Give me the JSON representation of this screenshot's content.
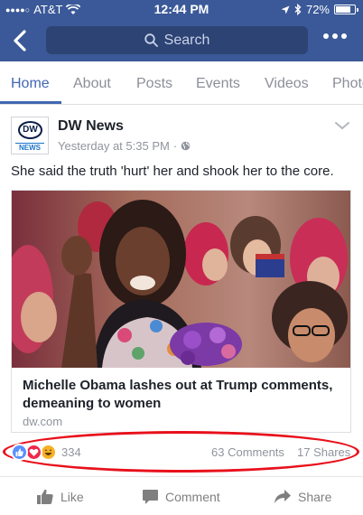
{
  "status_bar": {
    "carrier": "AT&T",
    "time": "12:44 PM",
    "battery": "72%"
  },
  "nav": {
    "search_label": "Search"
  },
  "tabs": [
    {
      "label": "Home",
      "active": true
    },
    {
      "label": "About",
      "active": false
    },
    {
      "label": "Posts",
      "active": false
    },
    {
      "label": "Events",
      "active": false
    },
    {
      "label": "Videos",
      "active": false
    },
    {
      "label": "Photos",
      "active": false
    }
  ],
  "post": {
    "page_name": "DW News",
    "avatar": {
      "logo_text": "DW",
      "badge": "NEWS"
    },
    "time": "Yesterday at 5:35 PM",
    "privacy_icon": "globe-icon",
    "text": "She said the truth 'hurt' her and shook her to the core.",
    "link": {
      "title": "Michelle Obama lashes out at Trump comments, demeaning to women",
      "domain": "dw.com"
    },
    "reactions": {
      "icons": [
        "like-reaction-icon",
        "love-reaction-icon",
        "haha-reaction-icon"
      ],
      "count": "334",
      "comments": "63 Comments",
      "shares": "17 Shares"
    }
  },
  "actions": {
    "like": "Like",
    "comment": "Comment",
    "share": "Share"
  },
  "colors": {
    "brand_blue": "#3b5998",
    "active_tab": "#4267b2",
    "highlight_red": "#e8101b"
  }
}
